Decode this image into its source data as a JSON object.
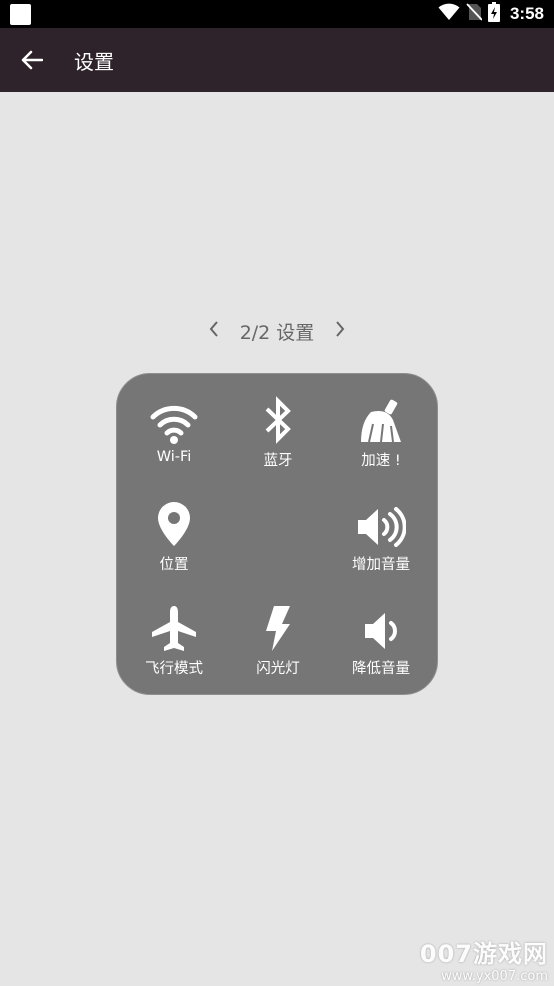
{
  "status_bar": {
    "time": "3:58"
  },
  "app_bar": {
    "title": "设置"
  },
  "pager": {
    "label": "2/2 设置"
  },
  "panel": {
    "items": [
      {
        "label": "Wi-Fi",
        "icon": "wifi-icon"
      },
      {
        "label": "蓝牙",
        "icon": "bluetooth-icon"
      },
      {
        "label": "加速 !",
        "icon": "broom-icon"
      },
      {
        "label": "位置",
        "icon": "location-pin-icon"
      },
      {
        "label": "增加音量",
        "icon": "volume-up-icon"
      },
      {
        "label": "飞行模式",
        "icon": "airplane-icon"
      },
      {
        "label": "闪光灯",
        "icon": "flash-icon"
      },
      {
        "label": "降低音量",
        "icon": "volume-down-icon"
      }
    ]
  },
  "watermark": {
    "main": "007游戏网",
    "sub": "www.yx007.com"
  }
}
